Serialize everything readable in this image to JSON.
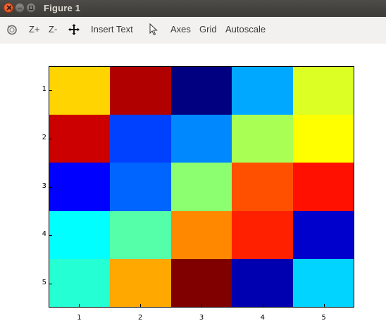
{
  "window": {
    "title": "Figure 1"
  },
  "toolbar": {
    "items": [
      {
        "name": "rotate-icon",
        "label": ""
      },
      {
        "name": "zoom-in-button",
        "label": "Z+"
      },
      {
        "name": "zoom-out-button",
        "label": "Z-"
      },
      {
        "name": "pan-icon",
        "label": ""
      },
      {
        "name": "insert-text-button",
        "label": "Insert Text"
      },
      {
        "name": "select-pointer-icon",
        "label": ""
      },
      {
        "name": "axes-button",
        "label": "Axes"
      },
      {
        "name": "grid-button",
        "label": "Grid"
      },
      {
        "name": "autoscale-button",
        "label": "Autoscale"
      }
    ],
    "zoom_in_label": "Z+",
    "zoom_out_label": "Z-",
    "insert_text_label": "Insert Text",
    "axes_label": "Axes",
    "grid_label": "Grid",
    "autoscale_label": "Autoscale"
  },
  "chart_data": {
    "type": "heatmap",
    "title": "",
    "xlabel": "",
    "ylabel": "",
    "x_ticks": [
      "1",
      "2",
      "3",
      "4",
      "5"
    ],
    "y_ticks": [
      "1",
      "2",
      "3",
      "4",
      "5"
    ],
    "colormap": "jet",
    "grid": false,
    "cell_colors": [
      [
        "#ffd400",
        "#b00000",
        "#000080",
        "#00a8ff",
        "#dcff24"
      ],
      [
        "#cc0000",
        "#0040ff",
        "#0088ff",
        "#aaff55",
        "#ffff00"
      ],
      [
        "#0000ff",
        "#0064ff",
        "#8cff70",
        "#ff5000",
        "#ff1000"
      ],
      [
        "#00ffff",
        "#55ffaa",
        "#ff8800",
        "#ff2000",
        "#0000cc"
      ],
      [
        "#24ffd4",
        "#ffa800",
        "#800000",
        "#0000b0",
        "#00d4ff"
      ]
    ]
  }
}
